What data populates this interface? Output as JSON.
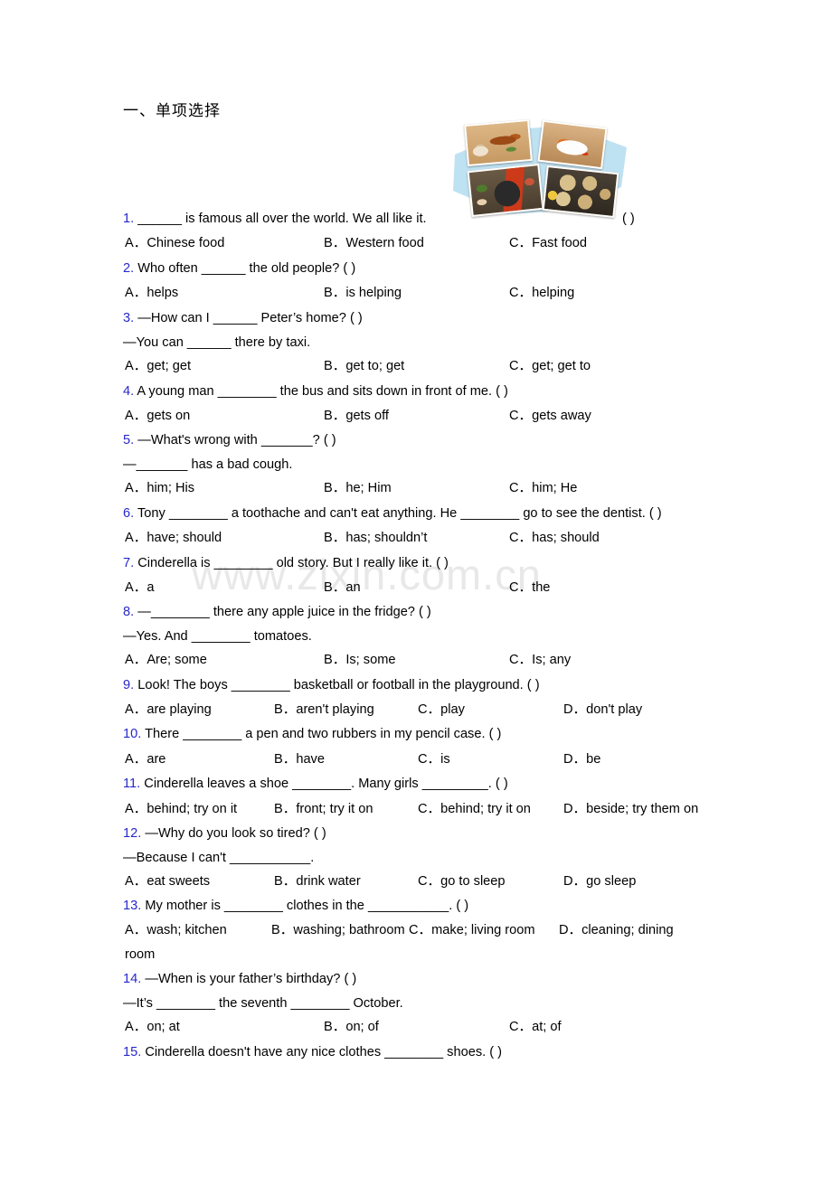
{
  "document": {
    "section_title": "一、单项选择",
    "watermark": "www.zixin.com.cn"
  },
  "collage": {
    "name": "chinese-food-photo-collage",
    "background_color": "#bfe2f2",
    "photos": [
      {
        "caption": "roast-duck-platter"
      },
      {
        "caption": "sweet-and-sour-dish-on-plate"
      },
      {
        "caption": "hot-pot-with-side-dishes"
      },
      {
        "caption": "dim-sum-bamboo-steamers"
      }
    ]
  },
  "questions": [
    {
      "num": "1.",
      "lines": [
        "______ is famous all over the world. We all like it."
      ],
      "trailing_paren": "( )",
      "trailing_paren_right": true,
      "options": [
        "A．Chinese food",
        "B．Western food",
        "C．Fast food"
      ],
      "cols": 3
    },
    {
      "num": "2.",
      "lines": [
        "Who often ______ the old people? ( )"
      ],
      "options": [
        "A．helps",
        "B．is helping",
        "C．helping"
      ],
      "cols": 3
    },
    {
      "num": "3.",
      "lines": [
        "—How can I ______ Peter’s home? ( )",
        "—You can ______ there by taxi."
      ],
      "options": [
        "A．get; get",
        "B．get to; get",
        "C．get; get to"
      ],
      "cols": 3
    },
    {
      "num": "4.",
      "lines": [
        "A young man ________ the bus and sits down in front of me. (    )"
      ],
      "options": [
        "A．gets on",
        "B．gets off",
        "C．gets away"
      ],
      "cols": 3
    },
    {
      "num": "5.",
      "lines": [
        "—What's wrong with _______? (    )",
        "—_______ has a bad cough."
      ],
      "options": [
        "A．him; His",
        "B．he; Him",
        "C．him; He"
      ],
      "cols": 3
    },
    {
      "num": "6.",
      "lines": [
        "Tony ________ a toothache and can't eat anything. He ________ go to see the dentist. (    )"
      ],
      "options": [
        "A．have; should",
        "B．has; shouldn’t",
        "C．has; should"
      ],
      "cols": 3
    },
    {
      "num": "7.",
      "lines": [
        "Cinderella is ________ old story. But I really like it. (    )"
      ],
      "options": [
        "A．a",
        "B．an",
        "C．the"
      ],
      "cols": 3
    },
    {
      "num": "8.",
      "lines": [
        "—________ there any apple juice in the fridge? (    )",
        "—Yes. And ________ tomatoes."
      ],
      "options": [
        "A．Are; some",
        "B．Is; some",
        "C．Is; any"
      ],
      "cols": 3
    },
    {
      "num": "9.",
      "lines": [
        "Look! The boys ________ basketball or football in the playground. ( )"
      ],
      "options": [
        "A．are playing",
        "B．aren't playing",
        "C．play",
        "D．don't play"
      ],
      "cols": 4
    },
    {
      "num": "10.",
      "lines": [
        "There ________ a pen and two rubbers in my pencil case. ( )"
      ],
      "options": [
        "A．are",
        "B．have",
        "C．is",
        "D．be"
      ],
      "cols": 4
    },
    {
      "num": "11.",
      "lines": [
        "Cinderella leaves a shoe ________. Many girls _________. ( )"
      ],
      "options": [
        "A．behind; try on it",
        "B．front; try it on",
        "C．behind; try it on",
        "D．beside; try them on"
      ],
      "cols": 4
    },
    {
      "num": "12.",
      "lines": [
        "—Why do you look so tired? ( )",
        "—Because I can't ___________."
      ],
      "options": [
        "A．eat sweets",
        "B．drink water",
        "C．go to sleep",
        "D．go sleep"
      ],
      "cols": 4
    },
    {
      "num": "13.",
      "lines": [
        "My mother is ________ clothes in the ___________. ( )"
      ],
      "options": [
        "A．wash; kitchen",
        "B．washing; bathroom",
        "C．make; living room",
        "D．cleaning; dining"
      ],
      "wrap_text": "room",
      "cols": 4
    },
    {
      "num": "14.",
      "lines": [
        "—When is your father’s birthday? (    )",
        "—It’s ________ the seventh ________ October."
      ],
      "options": [
        "A．on; at",
        "B．on; of",
        "C．at; of"
      ],
      "cols": 3
    },
    {
      "num": "15.",
      "lines": [
        "Cinderella doesn't have any nice clothes ________ shoes. ( )"
      ],
      "options": [],
      "cols": 0
    }
  ]
}
